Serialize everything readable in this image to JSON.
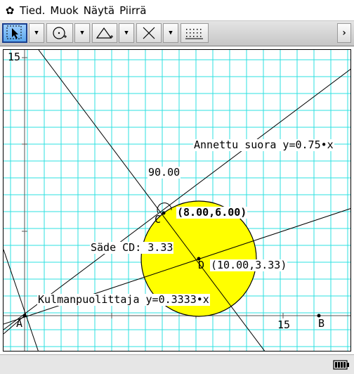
{
  "menu": {
    "items": [
      "Tied.",
      "Muok",
      "Näytä",
      "Piirrä"
    ]
  },
  "toolbar": {
    "tools": [
      "select-tool",
      "circle-tool",
      "triangle-tool",
      "perpendicular-tool",
      "grid-tool"
    ]
  },
  "graph": {
    "axis_max_y_label": "15",
    "axis_max_x_label": "15",
    "point_a_label": "A",
    "point_b_label": "B",
    "point_c_label": "C",
    "point_d_label": "D",
    "point_c_coords": "(8.00,6.00)",
    "point_d_coords": "(10.00,3.33)",
    "angle_label": "90.00",
    "radius_label": "Säde CD: 3.33",
    "given_line_label": "Annettu suora y=0.75•x",
    "bisector_label": "Kulmanpuolittaja y=0.3333•x",
    "colors": {
      "grid": "#2ee0e0",
      "circle_fill": "#ffff00",
      "lines": "#000000",
      "axis": "#555555"
    }
  },
  "status": {
    "battery_icon": "battery-icon"
  }
}
